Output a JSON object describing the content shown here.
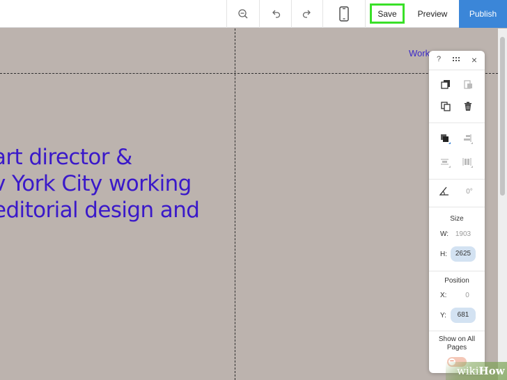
{
  "toolbar": {
    "zoom_out_icon": "zoom-out-icon",
    "undo_icon": "undo-icon",
    "redo_icon": "redo-icon",
    "mobile_icon": "mobile-view-icon",
    "save_label": "Save",
    "preview_label": "Preview",
    "publish_label": "Publish",
    "accent_color": "#3b86d8",
    "save_highlight_color": "#39e028"
  },
  "canvas": {
    "nav_link": "Work",
    "hero_lines": [
      " art director &",
      "v York City working",
      "editorial design and"
    ],
    "hero_color": "#3a19c9"
  },
  "panel": {
    "help_label": "?",
    "drag_handle_icon": "drag-handle-icon",
    "close_label": "×",
    "rotation_value": "0°",
    "size_label": "Size",
    "width_label": "W:",
    "width_value": "1903",
    "height_label": "H:",
    "height_value": "2625",
    "position_label": "Position",
    "x_label": "X:",
    "x_value": "0",
    "y_label": "Y:",
    "y_value": "681",
    "show_on_all_pages_label": "Show on All Pages",
    "show_on_all_pages_toggle": "−"
  },
  "watermark": {
    "part1": "wiki",
    "part2": "How"
  }
}
